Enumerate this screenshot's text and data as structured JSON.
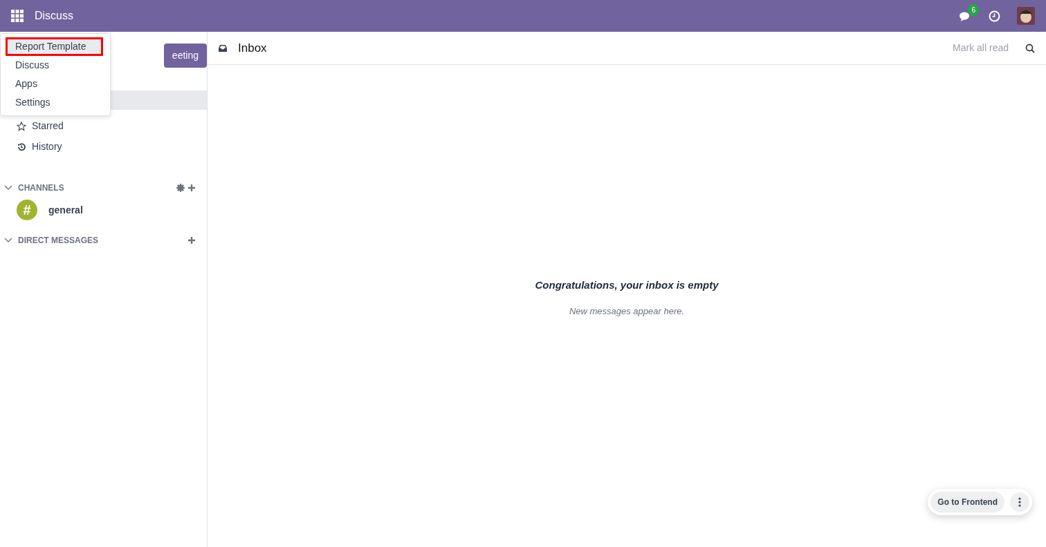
{
  "navbar": {
    "app_name": "Discuss",
    "messages_badge": "6"
  },
  "sidebar": {
    "meeting_button": "eeting",
    "mailboxes": [
      {
        "label": "Starred",
        "selected": false
      },
      {
        "label": "History",
        "selected": false
      }
    ],
    "sections": [
      {
        "title": "CHANNELS",
        "expanded": true,
        "settings": true,
        "items": [
          {
            "label": "general",
            "symbol": "#"
          }
        ]
      },
      {
        "title": "DIRECT MESSAGES",
        "expanded": true,
        "settings": false
      }
    ]
  },
  "app_menu": [
    {
      "label": "Report Template",
      "outlined": true,
      "selected": true
    },
    {
      "label": "Discuss",
      "outlined": false,
      "selected": false
    },
    {
      "label": "Apps",
      "outlined": false,
      "selected": false
    },
    {
      "label": "Settings",
      "outlined": false,
      "selected": false
    }
  ],
  "main": {
    "title": "Inbox",
    "mark_all_read": "Mark all read",
    "empty_title": "Congratulations, your inbox is empty",
    "empty_subtitle": "New messages appear here."
  },
  "frontend": {
    "button": "Go to Frontend"
  }
}
